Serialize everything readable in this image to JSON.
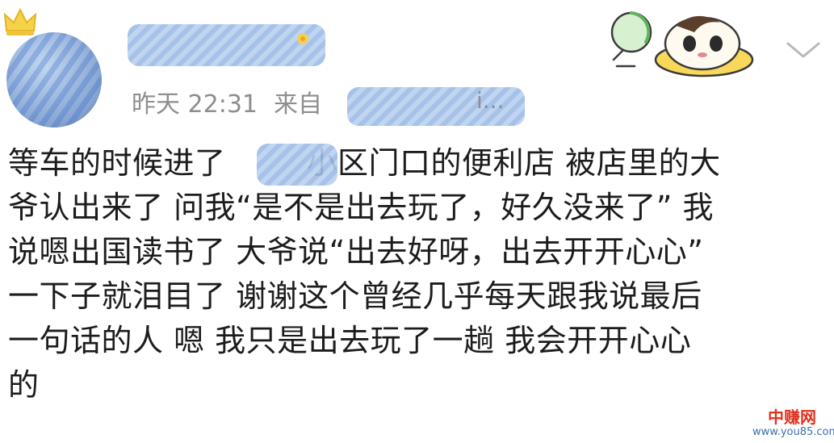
{
  "post": {
    "timestamp": "昨天 22:31",
    "source_prefix": "来自",
    "source_visible_fragment": "i...",
    "content_lines": [
      "等车的时候进了",
      "小区门口的便利店 被店里的大",
      "爷认出来了 问我“是不是出去玩了，好久没来了” 我",
      "说嗯出国读书了 大爷说“出去好呀，出去开开心心”",
      "一下子就泪目了 谢谢这个曾经几乎每天跟我说最后",
      "一句话的人 嗯 我只是出去玩了一趟 我会开开心心",
      "的"
    ]
  },
  "icons": {
    "avatar": "avatar",
    "crown": "crown-icon",
    "sticker": "sticker-icon",
    "chevron": "chevron-down-icon"
  },
  "watermark": {
    "name": "中赚网",
    "url": "www.you85.com"
  },
  "colors": {
    "meta_gray": "#8e8e8e",
    "text": "#1c1c1c",
    "blur_blue": "#9dbbe6",
    "watermark_red": "#e0301e",
    "watermark_blue": "#3a6fb0"
  }
}
